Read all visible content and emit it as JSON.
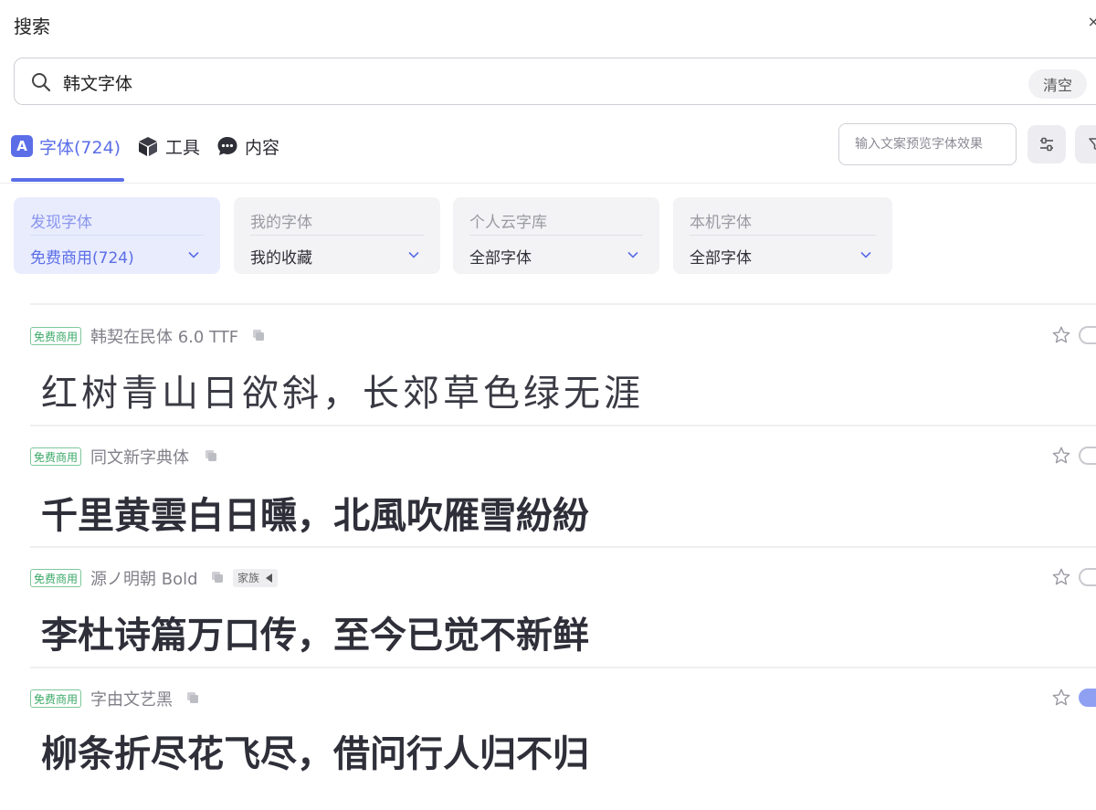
{
  "header": {
    "title": "搜索"
  },
  "search": {
    "value": "韩文字体",
    "clear_label": "清空"
  },
  "tabs": [
    {
      "label": "字体(724)",
      "icon": "a-letter-icon",
      "active": true
    },
    {
      "label": "工具",
      "icon": "cube-icon",
      "active": false
    },
    {
      "label": "内容",
      "icon": "chat-bubble-icon",
      "active": false
    }
  ],
  "tab_a_letter": "A",
  "preview": {
    "placeholder": "输入文案预览字体效果"
  },
  "toolbar": {
    "adjust_icon": "sliders-icon",
    "filter_icon": "filter-icon"
  },
  "filters": [
    {
      "label": "发现字体",
      "value": "免费商用(724)",
      "active": true
    },
    {
      "label": "我的字体",
      "value": "我的收藏",
      "active": false
    },
    {
      "label": "个人云字库",
      "value": "全部字体",
      "active": false
    },
    {
      "label": "本机字体",
      "value": "全部字体",
      "active": false
    }
  ],
  "fonts": [
    {
      "badge": "免费商用",
      "name": "韩契在民体 6.0 TTF",
      "preview": "红树青山日欲斜，长郊草色绿无涯",
      "family_tag": null,
      "toggle_on": false
    },
    {
      "badge": "免费商用",
      "name": "同文新字典体",
      "preview": "千里黄雲白日曛，北風吹雁雪紛紛",
      "family_tag": null,
      "toggle_on": false
    },
    {
      "badge": "免费商用",
      "name": "源ノ明朝 Bold",
      "preview": "李杜诗篇万口传，至今已觉不新鲜",
      "family_tag": "家族",
      "toggle_on": false
    },
    {
      "badge": "免费商用",
      "name": "字由文艺黑",
      "preview": "柳条折尽花飞尽，借问行人归不归",
      "family_tag": null,
      "toggle_on": true
    }
  ],
  "colors": {
    "accent": "#5b6ee8",
    "badge_green": "#3aa867"
  }
}
